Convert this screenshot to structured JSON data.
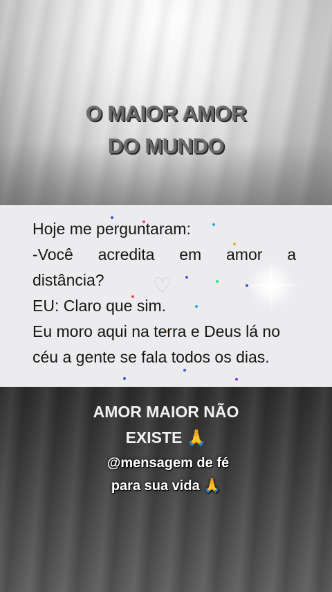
{
  "header": {
    "title_line1": "O MAIOR AMOR",
    "title_line2": "DO MUNDO"
  },
  "message": {
    "line1": "Hoje me perguntaram:",
    "line2_words": [
      "-Você",
      "acredita",
      "em",
      "amor",
      "a"
    ],
    "line3": "distância?",
    "line4": "EU: Claro que sim.",
    "line5": "Eu moro aqui na terra e Deus lá no",
    "line6": "céu a gente se fala todos os dias."
  },
  "footer": {
    "line1": "AMOR MAIOR NÃO",
    "line2": "EXISTE 🙏",
    "handle_line1": "@mensagem de fé",
    "handle_line2": "para sua vida 🙏"
  },
  "icons": {
    "heart": "heart-outline-icon",
    "praying_hands": "praying-hands-emoji"
  },
  "colors": {
    "title_text": "#6b6b6b",
    "message_text": "#161616",
    "message_panel": "#ecebee",
    "footer_text": "#f2f2f2"
  }
}
